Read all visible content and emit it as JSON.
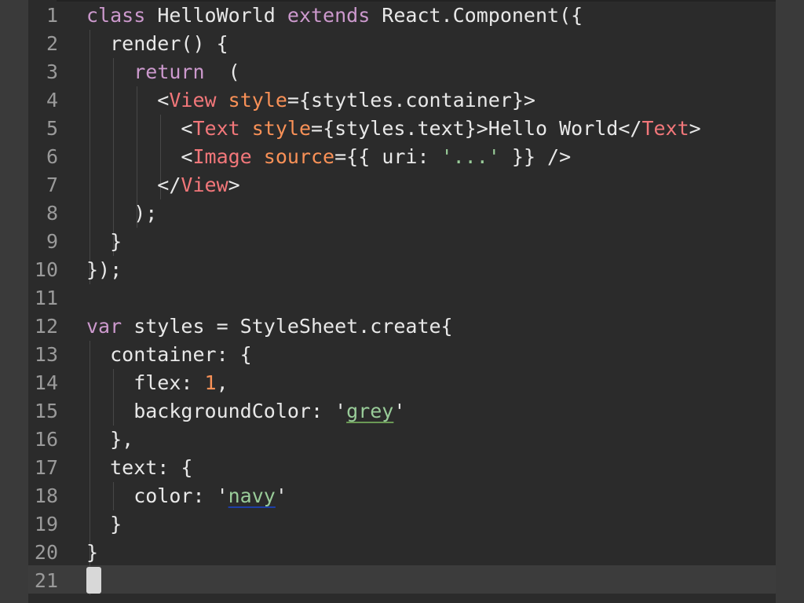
{
  "editor": {
    "lines": [
      {
        "n": "1",
        "parts": [
          [
            "kw",
            "class"
          ],
          [
            "plain",
            " HelloWorld "
          ],
          [
            "kw",
            "extends"
          ],
          [
            "plain",
            " React.Component({"
          ]
        ]
      },
      {
        "n": "2",
        "parts": [
          [
            "plain",
            "  render() {"
          ]
        ]
      },
      {
        "n": "3",
        "parts": [
          [
            "plain",
            "    "
          ],
          [
            "kw",
            "return"
          ],
          [
            "plain",
            "  ("
          ]
        ]
      },
      {
        "n": "4",
        "parts": [
          [
            "plain",
            "      <"
          ],
          [
            "tag",
            "View"
          ],
          [
            "plain",
            " "
          ],
          [
            "attr",
            "style"
          ],
          [
            "plain",
            "={stytles.container}>"
          ]
        ]
      },
      {
        "n": "5",
        "parts": [
          [
            "plain",
            "        <"
          ],
          [
            "tag",
            "Text"
          ],
          [
            "plain",
            " "
          ],
          [
            "attr",
            "style"
          ],
          [
            "plain",
            "={styles.text}>Hello World</"
          ],
          [
            "tag",
            "Text"
          ],
          [
            "plain",
            ">"
          ]
        ]
      },
      {
        "n": "6",
        "parts": [
          [
            "plain",
            "        <"
          ],
          [
            "tag",
            "Image"
          ],
          [
            "plain",
            " "
          ],
          [
            "attr",
            "source"
          ],
          [
            "plain",
            "={{ uri: "
          ],
          [
            "str",
            "'...'"
          ],
          [
            "plain",
            " }} />"
          ]
        ]
      },
      {
        "n": "7",
        "parts": [
          [
            "plain",
            "      </"
          ],
          [
            "tag",
            "View"
          ],
          [
            "plain",
            ">"
          ]
        ]
      },
      {
        "n": "8",
        "parts": [
          [
            "plain",
            "    );"
          ]
        ]
      },
      {
        "n": "9",
        "parts": [
          [
            "plain",
            "  }"
          ]
        ]
      },
      {
        "n": "10",
        "parts": [
          [
            "plain",
            "});"
          ]
        ]
      },
      {
        "n": "11",
        "parts": []
      },
      {
        "n": "12",
        "parts": [
          [
            "kw",
            "var"
          ],
          [
            "plain",
            " styles = StyleSheet.create{"
          ]
        ]
      },
      {
        "n": "13",
        "parts": [
          [
            "plain",
            "  container: {"
          ]
        ]
      },
      {
        "n": "14",
        "parts": [
          [
            "plain",
            "    flex: "
          ],
          [
            "num",
            "1"
          ],
          [
            "plain",
            ","
          ]
        ]
      },
      {
        "n": "15",
        "parts": [
          [
            "plain",
            "    backgroundColor: '"
          ],
          [
            "str u-green",
            "grey"
          ],
          [
            "plain",
            "'"
          ]
        ]
      },
      {
        "n": "16",
        "parts": [
          [
            "plain",
            "  },"
          ]
        ]
      },
      {
        "n": "17",
        "parts": [
          [
            "plain",
            "  text: {"
          ]
        ]
      },
      {
        "n": "18",
        "parts": [
          [
            "plain",
            "    color: '"
          ],
          [
            "str u-navy",
            "navy"
          ],
          [
            "plain",
            "'"
          ]
        ]
      },
      {
        "n": "19",
        "parts": [
          [
            "plain",
            "  }"
          ]
        ]
      },
      {
        "n": "20",
        "parts": [
          [
            "plain",
            "}"
          ]
        ]
      },
      {
        "n": "21",
        "parts": []
      }
    ],
    "current_line": "21",
    "colors": {
      "background": "#2b2b2b",
      "keyword": "#cc99cd",
      "tag": "#f2777a",
      "attribute": "#f99157",
      "string": "#99cc99",
      "line_number": "#9a9a9a"
    }
  }
}
